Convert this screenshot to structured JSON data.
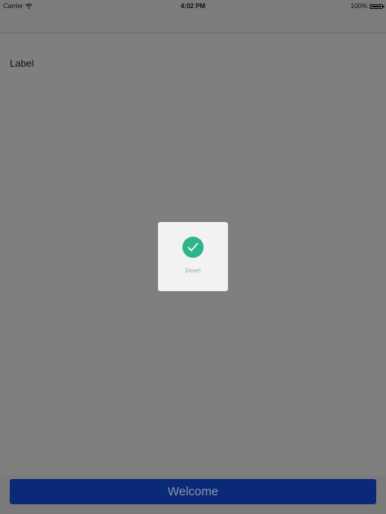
{
  "status_bar": {
    "carrier": "Carrier",
    "time": "4:02 PM",
    "battery": "100%",
    "battery_level": 1.0,
    "wifi_icon": "wifi-icon",
    "battery_icon": "battery-icon"
  },
  "content": {
    "label": "Label"
  },
  "hud": {
    "icon": "checkmark-icon",
    "text": "Done!",
    "accent_color": "#2db48a"
  },
  "bottom": {
    "button_label": "Welcome",
    "button_color": "#0a2a78"
  },
  "overlay_color": "#7f7f7f"
}
